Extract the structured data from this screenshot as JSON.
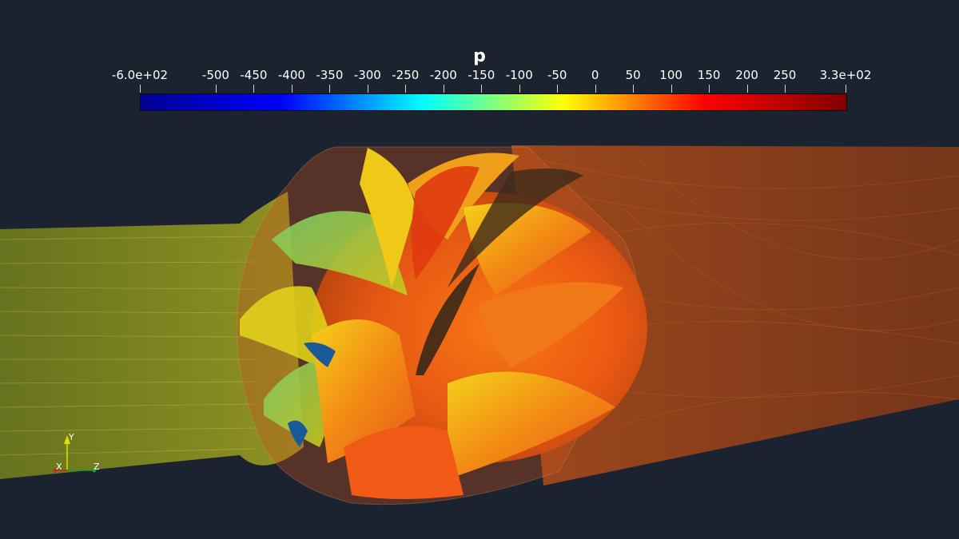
{
  "colorbar": {
    "title": "p",
    "ticks": [
      "-6.0e+02",
      "-500",
      "-450",
      "-400",
      "-350",
      "-300",
      "-250",
      "-200",
      "-150",
      "-100",
      "-50",
      "0",
      "50",
      "100",
      "150",
      "200",
      "250",
      "3.3e+02"
    ],
    "tick_values": [
      -600,
      -500,
      -450,
      -400,
      -350,
      -300,
      -250,
      -200,
      -150,
      -100,
      -50,
      0,
      50,
      100,
      150,
      200,
      250,
      330
    ],
    "range": [
      -600,
      330
    ],
    "colormap": [
      "#00008f",
      "#0000ff",
      "#00ffff",
      "#ffff00",
      "#ff0000",
      "#800000"
    ]
  },
  "orientation_axes": {
    "y_label": "Y",
    "x_label": "X",
    "z_label": "Z"
  },
  "colors": {
    "background": "#1b2330",
    "inlet_flow": "#b8c018",
    "outlet_flow": "#c84a10",
    "impeller_high": "#ff6010",
    "impeller_low": "#60c070"
  }
}
